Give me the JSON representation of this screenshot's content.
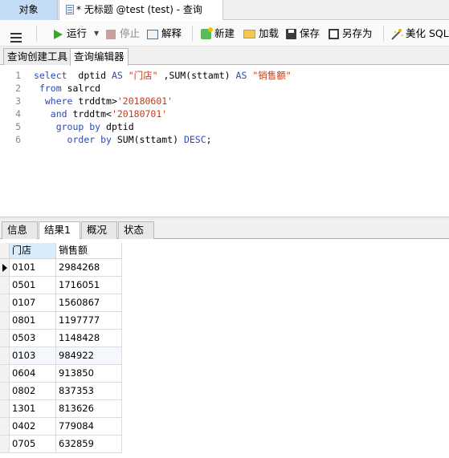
{
  "tabs": {
    "object": "对象",
    "query": "* 无标题 @test (test) - 查询"
  },
  "toolbar": {
    "run": "运行",
    "run_dropdown": "▼",
    "stop": "停止",
    "explain": "解释",
    "new": "新建",
    "load": "加载",
    "save": "保存",
    "save_as": "另存为",
    "beautify": "美化 SQL"
  },
  "subtabs": {
    "builder": "查询创建工具",
    "editor": "查询编辑器"
  },
  "editor": {
    "lines": [
      {
        "num": "1",
        "parts": [
          {
            "t": "select",
            "c": "kw"
          },
          {
            "t": "  dptid ",
            "c": ""
          },
          {
            "t": "AS",
            "c": "kw"
          },
          {
            "t": " ",
            "c": ""
          },
          {
            "t": "\"门店\"",
            "c": "str"
          },
          {
            "t": " ,SUM(sttamt) ",
            "c": ""
          },
          {
            "t": "AS",
            "c": "kw"
          },
          {
            "t": " ",
            "c": ""
          },
          {
            "t": "\"销售额\"",
            "c": "str"
          }
        ]
      },
      {
        "num": "2",
        "parts": [
          {
            "t": " ",
            "c": ""
          },
          {
            "t": "from",
            "c": "kw"
          },
          {
            "t": " salrcd",
            "c": ""
          }
        ]
      },
      {
        "num": "3",
        "parts": [
          {
            "t": "  ",
            "c": ""
          },
          {
            "t": "where",
            "c": "kw"
          },
          {
            "t": " trddtm>",
            "c": ""
          },
          {
            "t": "'20180601'",
            "c": "str"
          }
        ]
      },
      {
        "num": "4",
        "parts": [
          {
            "t": "   ",
            "c": ""
          },
          {
            "t": "and",
            "c": "kw"
          },
          {
            "t": " trddtm<",
            "c": ""
          },
          {
            "t": "'20180701'",
            "c": "str"
          }
        ]
      },
      {
        "num": "5",
        "parts": [
          {
            "t": "    ",
            "c": ""
          },
          {
            "t": "group by",
            "c": "kw"
          },
          {
            "t": " dptid",
            "c": ""
          }
        ]
      },
      {
        "num": "6",
        "parts": [
          {
            "t": "      ",
            "c": ""
          },
          {
            "t": "order by",
            "c": "kw"
          },
          {
            "t": " SUM(sttamt) ",
            "c": ""
          },
          {
            "t": "DESC",
            "c": "kw"
          },
          {
            "t": ";",
            "c": ""
          }
        ]
      }
    ]
  },
  "result_tabs": {
    "info": "信息",
    "result": "结果1",
    "profile": "概况",
    "status": "状态"
  },
  "grid": {
    "columns": [
      "门店",
      "销售额"
    ],
    "rows": [
      [
        "0101",
        "2984268"
      ],
      [
        "0501",
        "1716051"
      ],
      [
        "0107",
        "1560867"
      ],
      [
        "0801",
        "1197777"
      ],
      [
        "0503",
        "1148428"
      ],
      [
        "0103",
        "984922"
      ],
      [
        "0604",
        "913850"
      ],
      [
        "0802",
        "837353"
      ],
      [
        "1301",
        "813626"
      ],
      [
        "0402",
        "779084"
      ],
      [
        "0705",
        "632859"
      ]
    ]
  }
}
